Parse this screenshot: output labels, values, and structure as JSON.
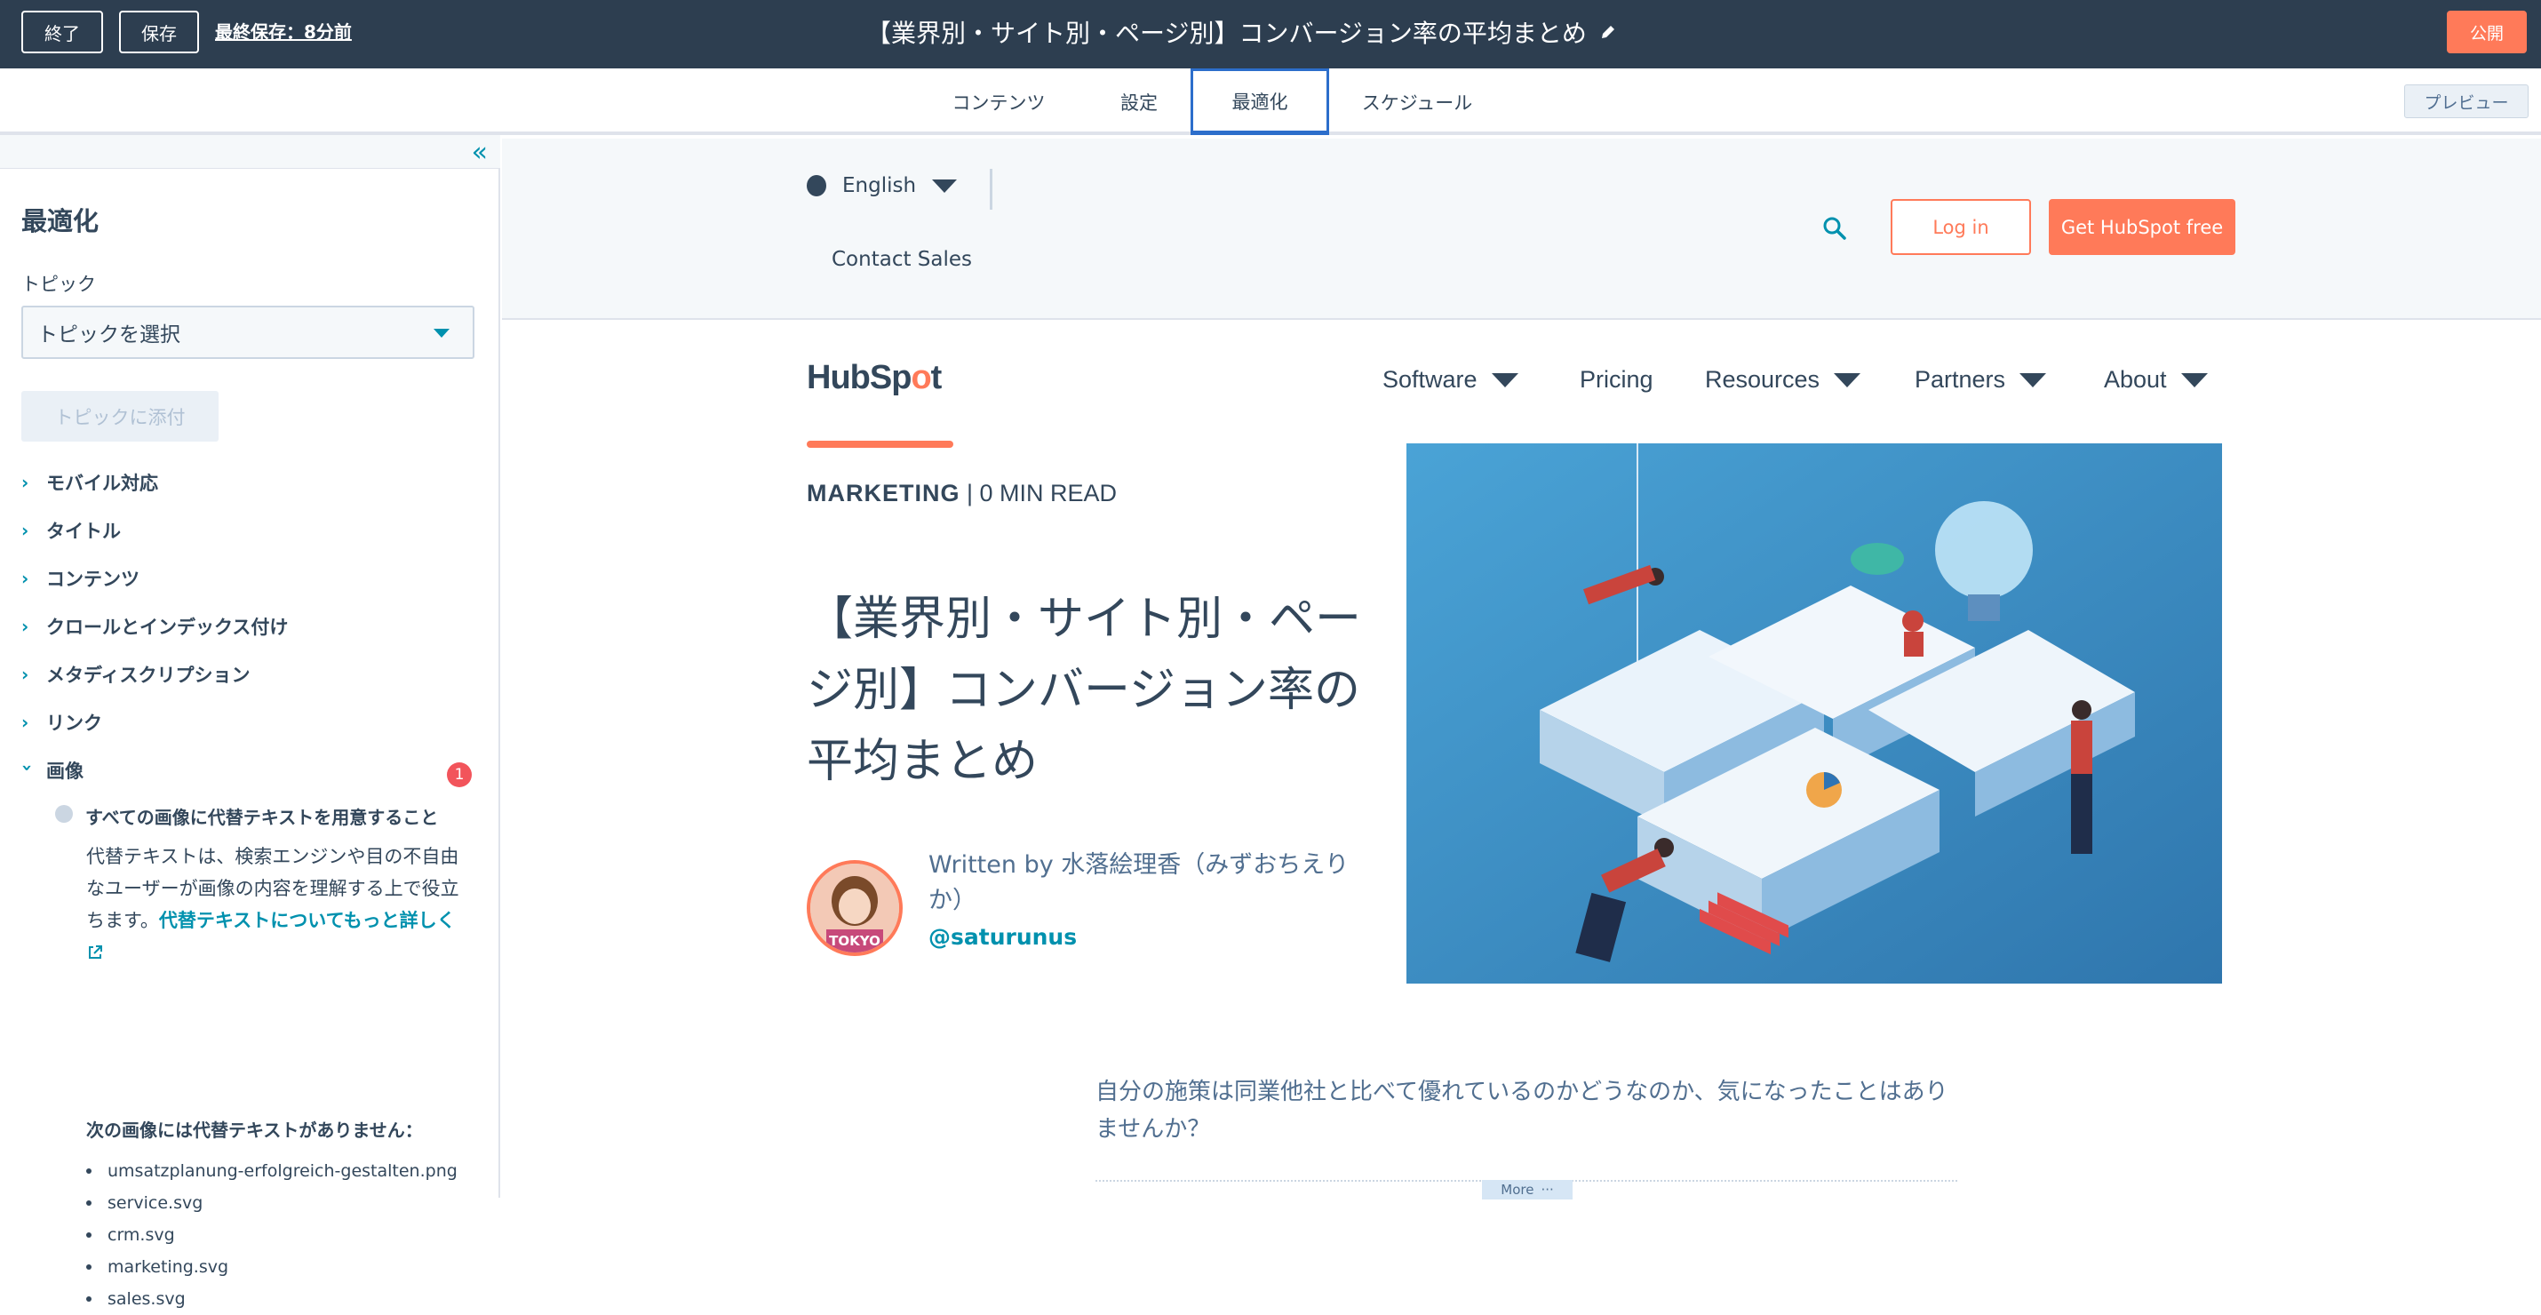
{
  "topbar": {
    "exit_label": "終了",
    "save_label": "保存",
    "last_saved": "最終保存：8分前",
    "title": "【業界別・サイト別・ページ別】コンバージョン率の平均まとめ",
    "publish_label": "公開"
  },
  "tabs": [
    {
      "label": "コンテンツ"
    },
    {
      "label": "設定"
    },
    {
      "label": "最適化",
      "active": true
    },
    {
      "label": "スケジュール"
    }
  ],
  "preview_label": "プレビュー",
  "sidebar": {
    "title": "最適化",
    "topic_label": "トピック",
    "topic_select": "トピックを選択",
    "attach_label": "トピックに添付",
    "sections": [
      {
        "label": "モバイル対応"
      },
      {
        "label": "タイトル"
      },
      {
        "label": "コンテンツ"
      },
      {
        "label": "クロールとインデックス付け"
      },
      {
        "label": "メタディスクリプション"
      },
      {
        "label": "リンク"
      },
      {
        "label": "画像",
        "expanded": true,
        "badge": "1"
      }
    ],
    "image_check": {
      "title": "すべての画像に代替テキストを用意すること",
      "desc_text": "代替テキストは、検索エンジンや目の不自由なユーザーが画像の内容を理解する上で役立ちます。",
      "learn_more": "代替テキストについてもっと詳しく",
      "missing_title": "次の画像には代替テキストがありません：",
      "missing_images": [
        "umsatzplanung-erfolgreich-gestalten.png",
        "service.svg",
        "crm.svg",
        "marketing.svg",
        "sales.svg"
      ]
    }
  },
  "site": {
    "language": "English",
    "contact": "Contact Sales",
    "login": "Log in",
    "get_free": "Get HubSpot free",
    "logo": {
      "part1": "HubSp",
      "part2": "o",
      "part3": "t"
    },
    "nav": [
      {
        "label": "Software",
        "dropdown": true
      },
      {
        "label": "Pricing",
        "dropdown": false
      },
      {
        "label": "Resources",
        "dropdown": true
      },
      {
        "label": "Partners",
        "dropdown": true
      },
      {
        "label": "About",
        "dropdown": true
      }
    ]
  },
  "article": {
    "category": "MARKETING",
    "read_time": "| 0 MIN READ",
    "title": "【業界別・サイト別・ページ別】コンバージョン率の平均まとめ",
    "author_by": "Written by 水落絵理香（みずおちえりか）",
    "author_handle": "@saturunus",
    "avatar_text": "TOKYO",
    "intro": "自分の施策は同業他社と比べて優れているのかどうなのか、気になったことはありませんか？",
    "more_label": "More"
  },
  "colors": {
    "topbar": "#2d3e50",
    "accent": "#ff7a59",
    "link": "#0091ae",
    "active_tab": "#2c6ecb",
    "badge": "#f2545b"
  }
}
